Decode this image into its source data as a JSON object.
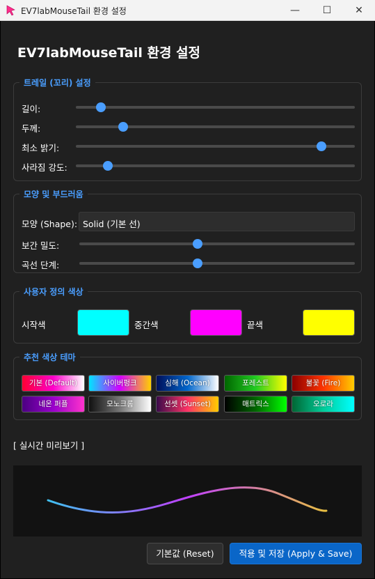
{
  "window": {
    "title": "EV7labMouseTail 환경 설정",
    "minimize": "—",
    "maximize": "☐",
    "close": "✕"
  },
  "heading": "EV7labMouseTail 환경 설정",
  "trail": {
    "title": "트레일 (꼬리) 설정",
    "sliders": [
      {
        "label": "길이:",
        "value": 0.09
      },
      {
        "label": "두께:",
        "value": 0.17
      },
      {
        "label": "최소 밝기:",
        "value": 0.88
      },
      {
        "label": "사라짐 강도:",
        "value": 0.115
      }
    ]
  },
  "shape": {
    "title": "모양 및 부드러움",
    "shape_label": "모양 (Shape):",
    "shape_value": "Solid (기본 선)",
    "sliders": [
      {
        "label": "보간 밀도:",
        "value": 0.43
      },
      {
        "label": "곡선 단계:",
        "value": 0.43
      }
    ]
  },
  "custom_colors": {
    "title": "사용자 정의 색상",
    "start_label": "시작색",
    "start_color": "#00ffff",
    "mid_label": "중간색",
    "mid_color": "#ff00ff",
    "end_label": "끝색",
    "end_color": "#ffff00"
  },
  "themes": {
    "title": "추천 색상 테마",
    "items": [
      {
        "label": "기본 (Default)",
        "gradient": "linear-gradient(90deg,#ff0033,#ff00cc,#ffffff)"
      },
      {
        "label": "사이버펑크",
        "gradient": "linear-gradient(90deg,#00e5ff,#d400ff,#ffd000)"
      },
      {
        "label": "심해 (Ocean)",
        "gradient": "linear-gradient(90deg,#00105a,#0066cc,#ffffff)"
      },
      {
        "label": "포레스트",
        "gradient": "linear-gradient(90deg,#006600,#22cc22,#ffff00)"
      },
      {
        "label": "불꽃 (Fire)",
        "gradient": "linear-gradient(90deg,#8b0000,#ff3300,#ffcc00)"
      },
      {
        "label": "네온 퍼플",
        "gradient": "linear-gradient(90deg,#4b0082,#9900cc,#ff33cc)"
      },
      {
        "label": "모노크롬",
        "gradient": "linear-gradient(90deg,#111111,#777777,#ffffff)"
      },
      {
        "label": "선셋 (Sunset)",
        "gradient": "linear-gradient(90deg,#3a0a4a,#ff3366,#ffcc00)"
      },
      {
        "label": "매트릭스",
        "gradient": "linear-gradient(90deg,#000000,#006600,#00ff00)"
      },
      {
        "label": "오로라",
        "gradient": "linear-gradient(90deg,#006633,#00cc99,#00ffff)"
      }
    ]
  },
  "preview": {
    "label": "[ 실시간 미리보기 ]",
    "gradient_stops": [
      "#40c0f0",
      "#c040ff",
      "#e8c040"
    ]
  },
  "buttons": {
    "reset": "기본값 (Reset)",
    "apply": "적용 및 저장 (Apply & Save)"
  }
}
